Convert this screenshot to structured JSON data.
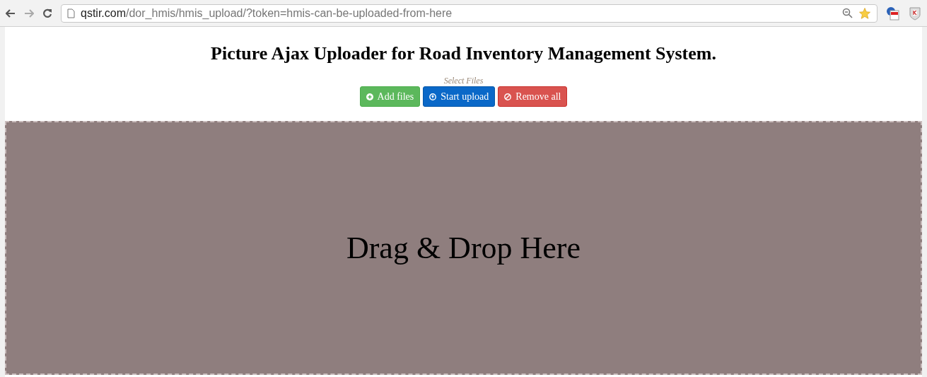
{
  "browser": {
    "url_host": "qstir.com",
    "url_path": "/dor_hmis/hmis_upload/?token=hmis-can-be-uploaded-from-here"
  },
  "page": {
    "title": "Picture Ajax Uploader for Road Inventory Management System.",
    "select_label": "Select Files",
    "buttons": [
      {
        "kind": "add",
        "label": "Add files"
      },
      {
        "kind": "start",
        "label": "Start upload"
      },
      {
        "kind": "remove",
        "label": "Remove all"
      }
    ],
    "drop_zone": "Drag & Drop Here"
  }
}
